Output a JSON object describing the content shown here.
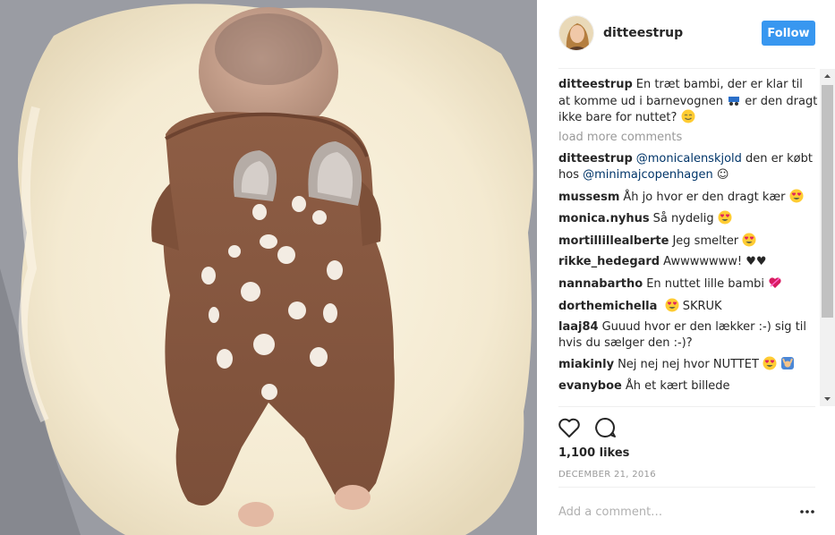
{
  "post": {
    "photo_icon": "baby-photo",
    "author": "ditteestrup",
    "follow_label": "Follow",
    "caption": {
      "user": "ditteestrup",
      "text": "En træt bambi, der er klar til at komme ud i barnevognen",
      "text_after": "er den dragt ikke bare for nuttet?",
      "emojis": [
        "stroller-emoji",
        "smile-emoji"
      ]
    },
    "load_more": "load more comments",
    "comments": [
      {
        "user": "ditteestrup",
        "pre": "",
        "mention1": "@monicalenskjold",
        "mid": " den er købt hos ",
        "mention2": "@minimajcopenhagen",
        "post": " ☺"
      },
      {
        "user": "mussesm",
        "text": "Åh jo hvor er den dragt kær",
        "emoji": "heart-eyes-emoji"
      },
      {
        "user": "monica.nyhus",
        "text": "Så nydelig",
        "emoji": "heart-eyes-emoji"
      },
      {
        "user": "mortillillealberte",
        "text": "Jeg smelter",
        "emoji": "heart-eyes-emoji"
      },
      {
        "user": "rikke_hedegard",
        "text": "Awwwwwww! ♥♥"
      },
      {
        "user": "nannabartho",
        "text": "En nuttet lille bambi",
        "emoji": "heart-ribbon-emoji"
      },
      {
        "user": "dorthemichella",
        "text": "SKRUK",
        "emoji": "heart-eyes-emoji"
      },
      {
        "user": "laaj84",
        "text": "Guuud hvor er den lækker :-) sig til hvis du sælger den :-)?"
      },
      {
        "user": "miakinly",
        "text": "Nej nej nej hvor NUTTET",
        "emoji": "heart-eyes-emoji"
      },
      {
        "user": "evanyboe",
        "text": "Åh et kært billede"
      }
    ],
    "likes": "1,100 likes",
    "date": "DECEMBER 21, 2016",
    "comment_placeholder": "Add a comment…",
    "icons": {
      "like": "heart-icon",
      "comment": "comment-bubble-icon",
      "more": "more-options-icon"
    }
  }
}
